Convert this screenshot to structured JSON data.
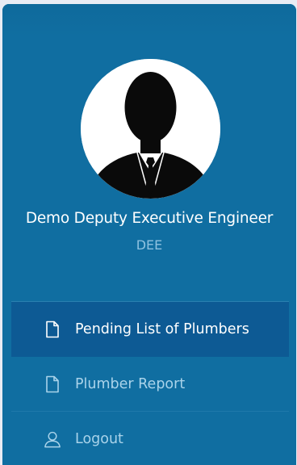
{
  "profile": {
    "name": "Demo Deputy Executive Engineer",
    "role": "DEE"
  },
  "menu": {
    "items": [
      {
        "label": "Pending List of Plumbers",
        "icon": "document-icon",
        "active": true
      },
      {
        "label": "Plumber Report",
        "icon": "document-icon",
        "active": false
      },
      {
        "label": "Logout",
        "icon": "user-icon",
        "active": false
      }
    ]
  },
  "colors": {
    "panel_bg": "#106ea1",
    "active_item_bg": "#0d5a94",
    "role_text": "#8fc2e0",
    "inactive_text": "#a9d3ea"
  }
}
